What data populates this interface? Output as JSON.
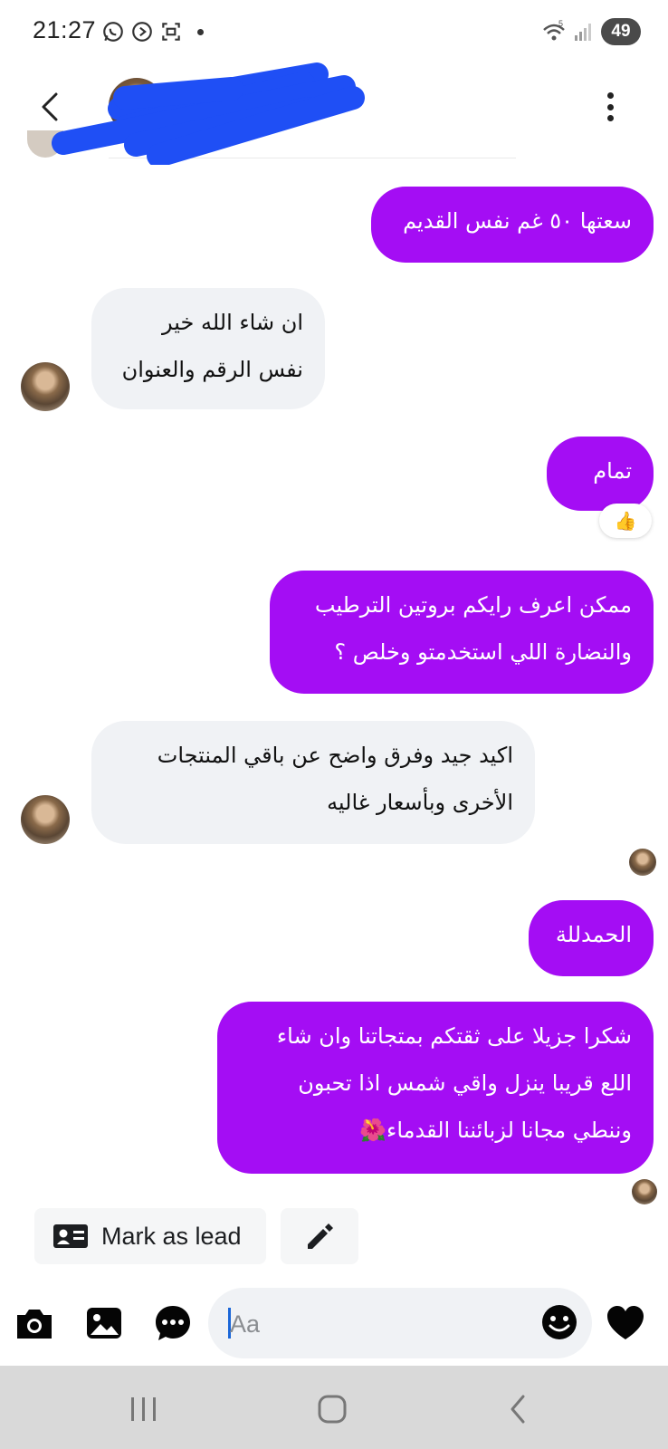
{
  "status_bar": {
    "time": "21:27",
    "battery": "49",
    "network_label": "5"
  },
  "header": {
    "contact_name": "",
    "name_redacted": true,
    "redaction_color": "#1f4ff5"
  },
  "messages": [
    {
      "direction": "outgoing",
      "lines": [
        "سعتها ٥٠ غم نفس القديم"
      ]
    },
    {
      "direction": "incoming",
      "lines": [
        "ان شاء الله خير",
        "نفس الرقم والعنوان"
      ]
    },
    {
      "direction": "outgoing",
      "lines": [
        "تمام"
      ],
      "reaction": "👍"
    },
    {
      "direction": "outgoing",
      "lines": [
        "ممكن اعرف رايكم بروتين الترطيب",
        "والنضارة اللي استخدمتو وخلص ؟"
      ]
    },
    {
      "direction": "incoming",
      "lines": [
        "اكيد جيد وفرق واضح عن باقي المنتجات",
        "الأخرى وبأسعار غاليه"
      ]
    },
    {
      "direction": "outgoing",
      "lines": [
        "الحمدللة"
      ]
    },
    {
      "direction": "outgoing",
      "lines": [
        "شكرا جزيلا على ثقتكم بمتجاتنا وان شاء",
        "اللع قريبا ينزل واقي شمس اذا تحبون",
        "وننطي مجانا لزبائننا القدماء🌺"
      ]
    }
  ],
  "actions": {
    "mark_as_lead": "Mark as lead",
    "lead_icon": "contact-card-icon",
    "edit_icon": "pencil-icon"
  },
  "composer": {
    "placeholder": "Aa",
    "icons": [
      "camera-icon",
      "image-icon",
      "chat-bubble-icon",
      "emoji-icon",
      "heart-icon"
    ]
  },
  "colors": {
    "outgoing_bubble": "#a40df4",
    "incoming_bubble": "#f0f2f5",
    "nav_bar": "#d9d9d9"
  }
}
